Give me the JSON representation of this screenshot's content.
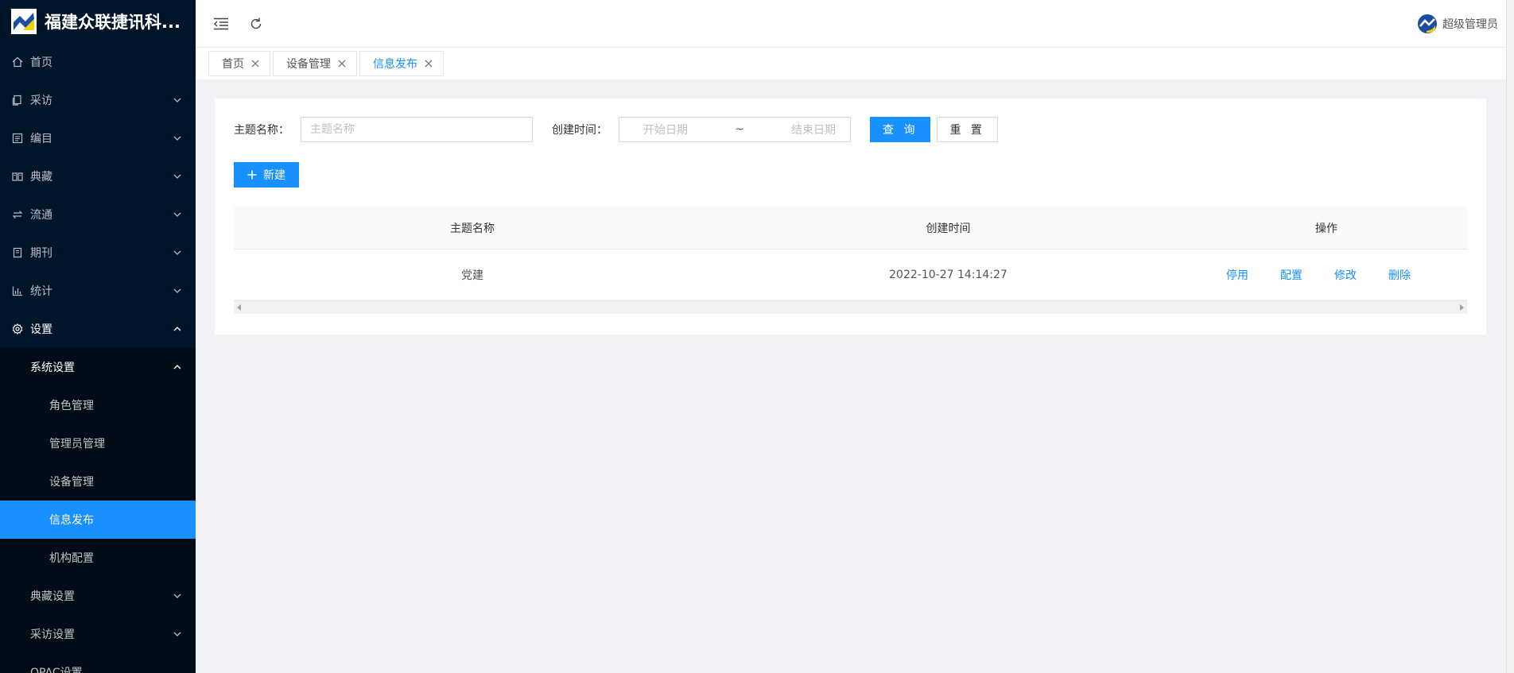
{
  "sidebar": {
    "title": "福建众联捷讯科...",
    "items": [
      {
        "label": "首页",
        "icon": "home-icon",
        "expandable": false
      },
      {
        "label": "采访",
        "icon": "file-copy-icon",
        "expandable": true
      },
      {
        "label": "编目",
        "icon": "catalog-icon",
        "expandable": true
      },
      {
        "label": "典藏",
        "icon": "book-icon",
        "expandable": true
      },
      {
        "label": "流通",
        "icon": "swap-icon",
        "expandable": true
      },
      {
        "label": "期刊",
        "icon": "journal-icon",
        "expandable": true
      },
      {
        "label": "统计",
        "icon": "bar-chart-icon",
        "expandable": true
      },
      {
        "label": "设置",
        "icon": "gear-icon",
        "expandable": true,
        "open": true
      }
    ],
    "settings_sub": {
      "system": "系统设置",
      "system_children": [
        "角色管理",
        "管理员管理",
        "设备管理",
        "信息发布",
        "机构配置"
      ],
      "collection": "典藏设置",
      "acquisition": "采访设置",
      "partial": "OPAC设置"
    }
  },
  "header": {
    "user_name": "超级管理员"
  },
  "tabs": [
    {
      "label": "首页"
    },
    {
      "label": "设备管理"
    },
    {
      "label": "信息发布",
      "active": true
    }
  ],
  "search": {
    "topic_label": "主题名称：",
    "topic_placeholder": "主题名称",
    "time_label": "创建时间：",
    "start_placeholder": "开始日期",
    "separator": "~",
    "end_placeholder": "结束日期",
    "query_button": "查 询",
    "reset_button": "重 置"
  },
  "new_button": "新建",
  "table": {
    "columns": [
      "主题名称",
      "创建时间",
      "操作"
    ],
    "rows": [
      {
        "name": "党建",
        "created": "2022-10-27 14:14:27",
        "actions": [
          "停用",
          "配置",
          "修改",
          "删除"
        ]
      }
    ]
  },
  "colors": {
    "sidebar_bg": "#001529",
    "primary": "#1890ff"
  }
}
